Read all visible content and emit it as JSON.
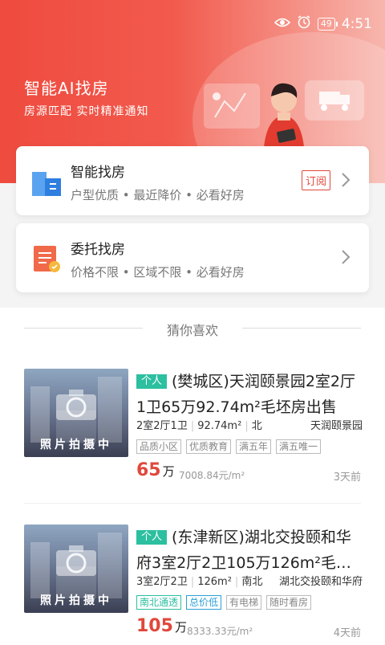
{
  "status_bar": {
    "time": "4:51",
    "battery": "49"
  },
  "hero": {
    "title": "智能AI找房",
    "subtitle": "房源匹配 实时精准通知"
  },
  "cards": [
    {
      "title": "智能找房",
      "subtitle": "户型优质 • 最近降价 • 必看好房",
      "badge": "订阅"
    },
    {
      "title": "委托找房",
      "subtitle": "价格不限 • 区域不限 • 必看好房"
    }
  ],
  "section_title": "猜你喜欢",
  "thumb_label": "照片拍摄中",
  "listings": [
    {
      "tag": "个人",
      "title": "(樊城区)天润颐景园2室2厅1卫65万92.74m²毛坯房出售",
      "layout": "2室2厅1卫",
      "area": "92.74m²",
      "orientation": "北",
      "community": "天润颐景园",
      "tags": [
        "品质小区",
        "优质教育",
        "满五年",
        "满五唯一"
      ],
      "price": "65",
      "price_unit": "万",
      "unit_price": "7008.84元/m²",
      "posted": "3天前"
    },
    {
      "tag": "个人",
      "title": "(东津新区)湖北交投颐和华府3室2厅2卫105万126m²毛…",
      "layout": "3室2厅2卫",
      "area": "126m²",
      "orientation": "南北",
      "community": "湖北交投颐和华府",
      "tags": [
        "南北通透",
        "总价低",
        "有电梯",
        "随时看房"
      ],
      "price": "105",
      "price_unit": "万",
      "unit_price": "8333.33元/m²",
      "posted": "4天前"
    }
  ],
  "colors": {
    "accent": "#e0483c",
    "personal_tag": "#2cbfa0",
    "hero_start": "#ef4b3f"
  }
}
